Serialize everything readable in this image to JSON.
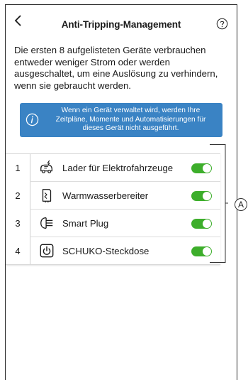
{
  "header": {
    "title": "Anti-Tripping-Management"
  },
  "intro_text": "Die ersten 8 aufgelisteten Geräte verbrauchen entweder weniger Strom oder werden ausgeschaltet, um eine Auslösung zu verhindern, wenn sie gebraucht werden.",
  "info_banner": {
    "text": "Wenn ein Gerät verwaltet wird, werden Ihre Zeitpläne, Momente und Automatisierungen für dieses Gerät nicht ausgeführt.",
    "icon": "info-icon"
  },
  "devices": [
    {
      "index": "1",
      "name": "Lader für Elektrofahrzeuge",
      "icon": "ev-charger-icon",
      "enabled": true
    },
    {
      "index": "2",
      "name": "Warmwasserbereiter",
      "icon": "water-heater-icon",
      "enabled": true
    },
    {
      "index": "3",
      "name": "Smart Plug",
      "icon": "smart-plug-icon",
      "enabled": true
    },
    {
      "index": "4",
      "name": "SCHUKO-Steckdose",
      "icon": "schuko-socket-icon",
      "enabled": true
    }
  ],
  "callout_label": "A",
  "colors": {
    "accent_blue": "#3a83c4",
    "toggle_on": "#3dae2b",
    "text": "#1a1a1a"
  }
}
